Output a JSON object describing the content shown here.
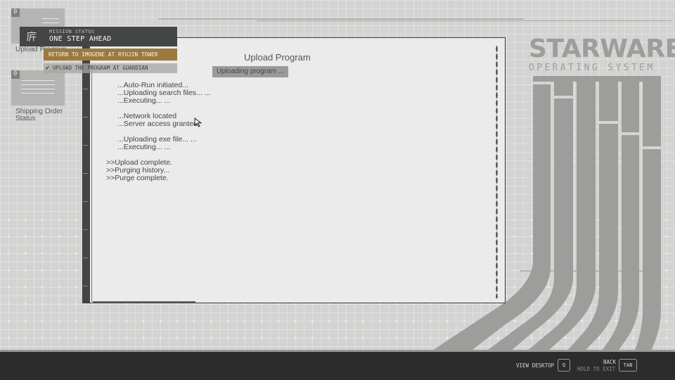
{
  "desktop": {
    "icons": [
      {
        "label": "Upload Program",
        "tab": "0"
      },
      {
        "label": "Shipping Order Status",
        "tab": "0"
      }
    ]
  },
  "brand": {
    "title": "STARWARE",
    "subtitle": "OPERATING SYSTEM"
  },
  "terminal": {
    "title": "Upload Program",
    "status": "Uploading program ...",
    "lines": [
      "...Auto-Run initiated...",
      "...Uploading search files... ...",
      "...Executing... ...",
      "",
      "...Network located",
      "...Server access granted",
      "",
      "...Uploading exe file... ...",
      "...Executing... ...",
      "",
      ">>Upload complete.",
      ">>Purging history...",
      ">>Purge complete."
    ]
  },
  "mission": {
    "label": "MISSION STATUS",
    "title": "ONE STEP AHEAD",
    "objective_active": "RETURN TO IMOGENE AT RYUJIN TOWER",
    "objective_done": "UPLOAD THE PROGRAM AT GUARDIAN"
  },
  "footer": {
    "view_desktop": "VIEW DESKTOP",
    "view_desktop_key": "Q",
    "back": "BACK",
    "hold_to_exit": "HOLD TO EXIT",
    "back_key": "TAB"
  },
  "colors": {
    "background": "#d3d4d2",
    "brand": "#9d9e9c",
    "objective_accent": "#9c7a3f",
    "bottom_bar": "#2c2c2c"
  },
  "icons": {
    "cursor": "mouse-pointer-icon",
    "check": "check-icon",
    "mission_glyph": "mission-glyph-icon"
  }
}
